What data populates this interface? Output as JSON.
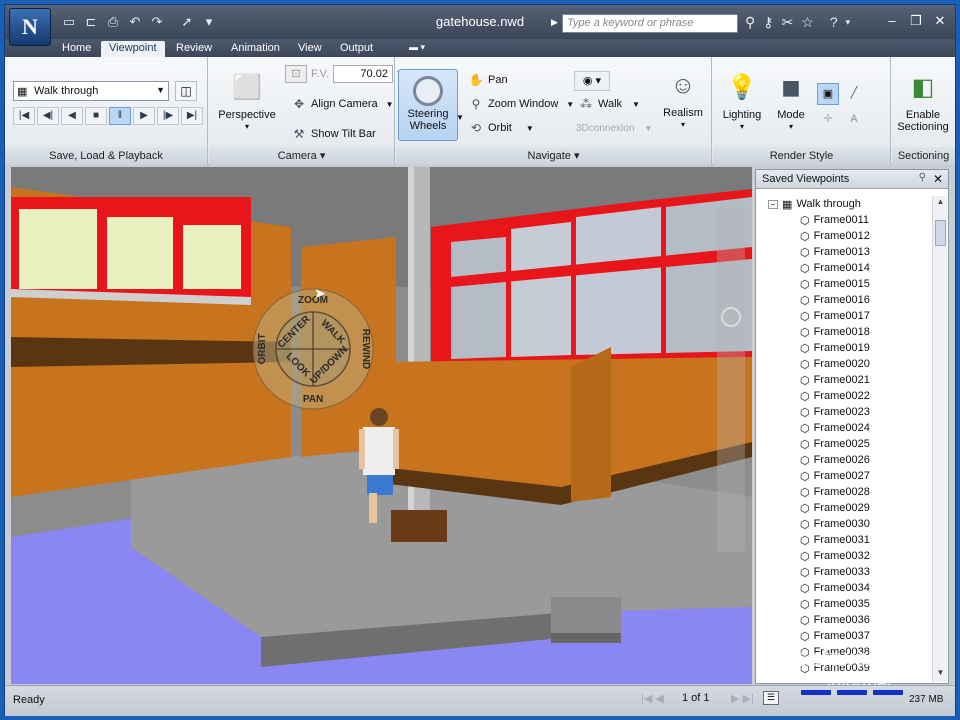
{
  "app": {
    "logo": "N",
    "document_title": "gatehouse.nwd"
  },
  "search": {
    "placeholder": "Type a keyword or phrase"
  },
  "tabs": [
    {
      "label": "Home"
    },
    {
      "label": "Viewpoint"
    },
    {
      "label": "Review"
    },
    {
      "label": "Animation"
    },
    {
      "label": "View"
    },
    {
      "label": "Output"
    }
  ],
  "ribbon": {
    "save_load": {
      "combo_value": "Walk through",
      "panel_label": "Save, Load & Playback"
    },
    "camera": {
      "perspective": "Perspective",
      "fov_label": "F.V.",
      "fov_value": "70.02",
      "align_camera": "Align Camera",
      "show_tilt_bar": "Show Tilt Bar",
      "panel_label": "Camera"
    },
    "navigate": {
      "steering_wheels": "Steering Wheels",
      "pan": "Pan",
      "zoom_window": "Zoom Window",
      "orbit": "Orbit",
      "walk": "Walk",
      "connexion": "3Dconnexion",
      "realism": "Realism",
      "panel_label": "Navigate"
    },
    "render_style": {
      "lighting": "Lighting",
      "mode": "Mode",
      "panel_label": "Render Style"
    },
    "sectioning": {
      "enable": "Enable Sectioning",
      "panel_label": "Sectioning"
    }
  },
  "wheel": {
    "zoom": "ZOOM",
    "rewind": "REWIND",
    "pan": "PAN",
    "orbit": "ORBIT",
    "center": "CENTER",
    "walk": "WALK",
    "look": "LOOK",
    "updown": "UP/DOWN"
  },
  "saved_viewpoints": {
    "title": "Saved Viewpoints",
    "root": "Walk through",
    "frames": [
      "Frame0011",
      "Frame0012",
      "Frame0013",
      "Frame0014",
      "Frame0015",
      "Frame0016",
      "Frame0017",
      "Frame0018",
      "Frame0019",
      "Frame0020",
      "Frame0021",
      "Frame0022",
      "Frame0023",
      "Frame0024",
      "Frame0025",
      "Frame0026",
      "Frame0027",
      "Frame0028",
      "Frame0029",
      "Frame0030",
      "Frame0031",
      "Frame0032",
      "Frame0033",
      "Frame0034",
      "Frame0035",
      "Frame0036",
      "Frame0037",
      "Frame0038",
      "Frame0039"
    ]
  },
  "status": {
    "ready": "Ready",
    "page": "1 of 1",
    "memory": "237 MB"
  },
  "watermark": {
    "line1": "software",
    "line2": "informer"
  },
  "colors": {
    "accent": "#1a5fb4",
    "titlebar": "#3b4658",
    "frame_red": "#e8151b",
    "wall_orange": "#c8741e",
    "floor_blue": "#8a86f2"
  }
}
